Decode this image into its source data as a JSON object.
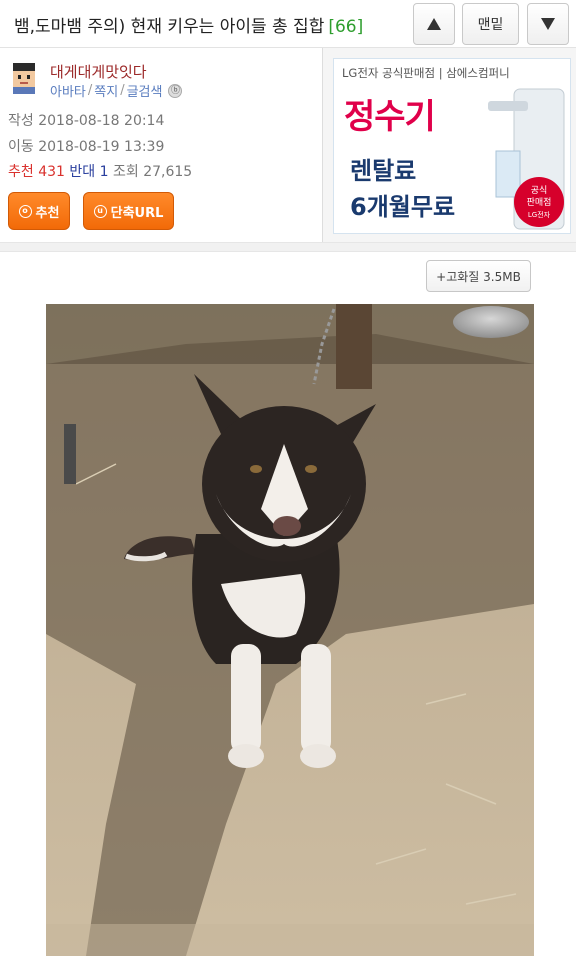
{
  "header": {
    "title": "뱀,도마뱀 주의) 현재 키우는 아이들 총 집합",
    "comment_count": "[66]",
    "up_icon": "triangle-up-icon",
    "bottom_label": "맨밑",
    "down_icon": "triangle-down-icon"
  },
  "author": {
    "nickname": "대게대게맛잇다",
    "links": [
      "아바타",
      "쪽지",
      "글검색"
    ],
    "created_label": "작성",
    "created": "2018-08-18 20:14",
    "moved_label": "이동",
    "moved": "2018-08-19 13:39",
    "recommend_label": "추천",
    "recommend_count": "431",
    "oppose_label": "반대",
    "oppose_count": "1",
    "views_label": "조회",
    "views": "27,615",
    "recommend_button": "추천",
    "shorturl_button": "단축URL"
  },
  "ad": {
    "brand": "LG전자 공식판매점 | 삼에스컴퍼니",
    "headline": "정수기",
    "line1": "렌탈료",
    "line2": "6개월무료",
    "badge_lines": [
      "공식",
      "판매점",
      "LG전자"
    ]
  },
  "hq_button": "+고화질 3.5MB",
  "colors": {
    "orange": "#f26a08",
    "recommend_red": "#d9322e",
    "oppose_blue": "#2a3f9e",
    "comment_green": "#2e9e2e"
  }
}
